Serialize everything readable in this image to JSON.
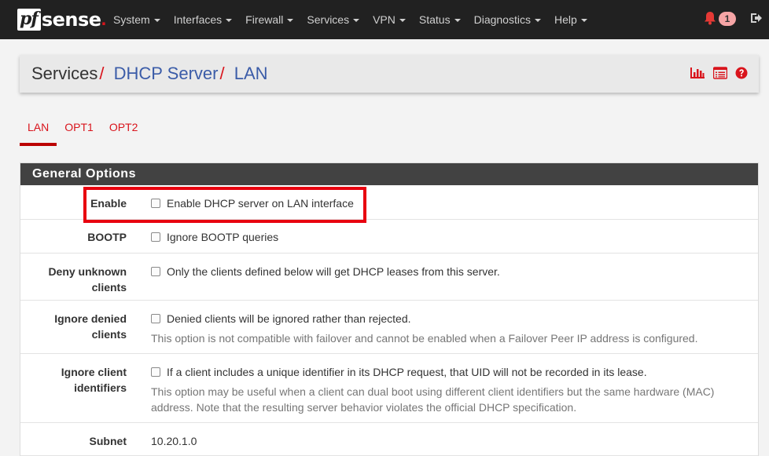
{
  "brand": {
    "logo_pf": "pf",
    "logo_sense": "sense"
  },
  "nav": {
    "items": [
      "System",
      "Interfaces",
      "Firewall",
      "Services",
      "VPN",
      "Status",
      "Diagnostics",
      "Help"
    ],
    "notification_count": "1"
  },
  "breadcrumb": {
    "root": "Services",
    "sep": "/",
    "level1": "DHCP Server",
    "level2": "LAN"
  },
  "tabs": [
    "LAN",
    "OPT1",
    "OPT2"
  ],
  "panel": {
    "title": "General Options",
    "rows": [
      {
        "label": "Enable",
        "text": "Enable DHCP server on LAN interface"
      },
      {
        "label": "BOOTP",
        "text": "Ignore BOOTP queries"
      },
      {
        "label_l1": "Deny unknown",
        "label_l2": "clients",
        "text": "Only the clients defined below will get DHCP leases from this server."
      },
      {
        "label_l1": "Ignore denied",
        "label_l2": "clients",
        "text": "Denied clients will be ignored rather than rejected.",
        "help": "This option is not compatible with failover and cannot be enabled when a Failover Peer IP address is configured."
      },
      {
        "label_l1": "Ignore client",
        "label_l2": "identifiers",
        "text": "If a client includes a unique identifier in its DHCP request, that UID will not be recorded in its lease.",
        "help_l1": "This option may be useful when a client can dual boot using different client identifiers but the same hardware (MAC)",
        "help_l2": "address. Note that the resulting server behavior violates the official DHCP specification."
      },
      {
        "label": "Subnet",
        "value": "10.20.1.0"
      }
    ]
  },
  "colors": {
    "accent": "#d9141c",
    "navbar": "#212121",
    "link": "#3b5ca8",
    "panel_heading": "#424242"
  }
}
